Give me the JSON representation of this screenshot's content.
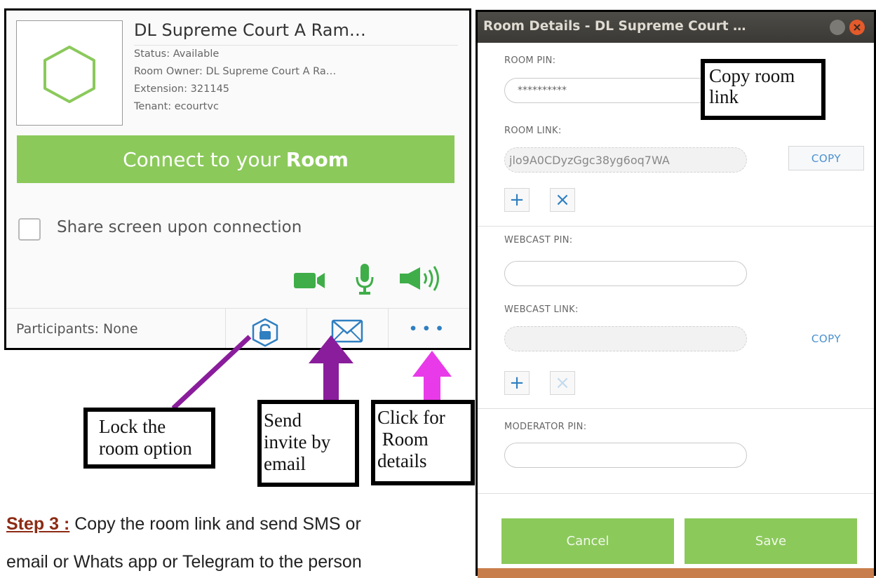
{
  "room_card": {
    "title": "DL Supreme Court A Ram…",
    "status": "Status: Available",
    "owner": "Room Owner: DL Supreme Court A Ra…",
    "extension": "Extension: 321145",
    "tenant": "Tenant: ecourtvc",
    "connect_prefix": "Connect to your",
    "connect_bold": "Room",
    "share_label": "Share screen upon connection",
    "participants": "Participants: None",
    "more_label": "• • •",
    "colors": {
      "accent_green": "#8bc95b",
      "icon_green": "#3fae49",
      "icon_blue": "#2f7fc1"
    }
  },
  "annotations": {
    "lock_line1": "Lock the",
    "lock_line2": "room option",
    "send_line1": "Send",
    "send_line2": "invite by",
    "send_line3": "email",
    "click_line1": "Click for",
    "click_line2": " Room",
    "click_line3": "details",
    "copy_line1": "Copy room",
    "copy_line2": "link",
    "arrow_colors": {
      "purple": "#8a1d9c",
      "magenta": "#e83ae8"
    }
  },
  "step": {
    "label": "Step 3 :",
    "line1": " Copy the room link and send SMS or",
    "line2": "email or Whats app or Telegram to the person"
  },
  "dialog": {
    "title": "Room Details - DL Supreme Court …",
    "room_pin_label": "ROOM PIN:",
    "room_pin_value": "**********",
    "room_link_label": "ROOM LINK:",
    "room_link_value": "jlo9A0CDyzGgc38yg6oq7WA",
    "copy_label": "COPY",
    "webcast_pin_label": "WEBCAST PIN:",
    "webcast_link_label": "WEBCAST LINK:",
    "moderator_pin_label": "MODERATOR PIN:",
    "add_symbol": "+",
    "remove_symbol": "×",
    "cancel_label": "Cancel",
    "save_label": "Save"
  }
}
